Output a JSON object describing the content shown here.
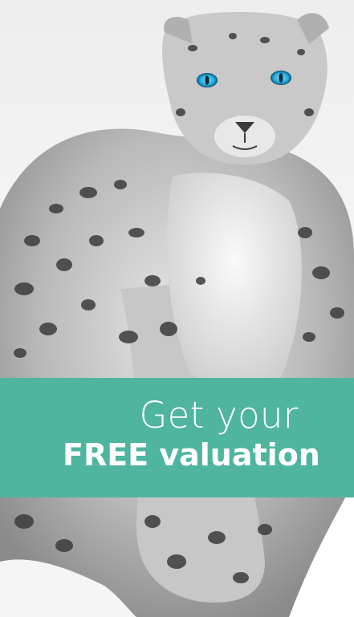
{
  "banner": {
    "line1": "Get your",
    "line2": "FREE valuation"
  },
  "colors": {
    "banner_bg": "#4fb59f",
    "banner_text": "#ffffff",
    "eyes": "#1ea7d8",
    "background": "#f3f3f3"
  },
  "images": {
    "hero": "snow-leopard-photo"
  }
}
